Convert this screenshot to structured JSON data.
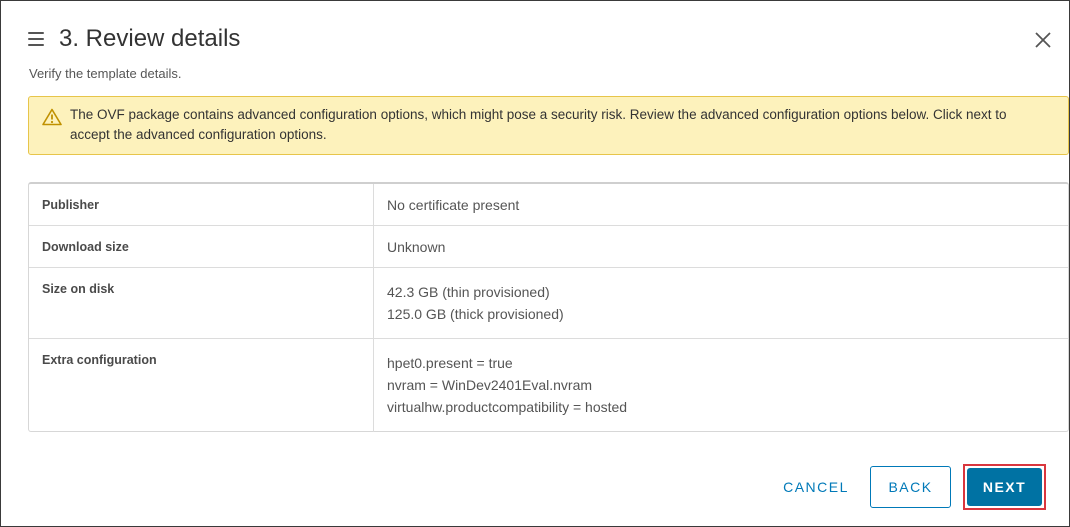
{
  "dialog": {
    "title": "3. Review details",
    "subtitle": "Verify the template details."
  },
  "alert": {
    "icon": "warning-triangle-icon",
    "text": "The OVF package contains advanced configuration options, which might pose a security risk. Review the advanced configuration options below. Click next to accept the advanced configuration options."
  },
  "details": [
    {
      "label": "Publisher",
      "values": [
        "No certificate present"
      ]
    },
    {
      "label": "Download size",
      "values": [
        "Unknown"
      ]
    },
    {
      "label": "Size on disk",
      "values": [
        "42.3 GB (thin provisioned)",
        "125.0 GB (thick provisioned)"
      ]
    },
    {
      "label": "Extra configuration",
      "values": [
        "hpet0.present = true",
        "nvram = WinDev2401Eval.nvram",
        "virtualhw.productcompatibility = hosted"
      ]
    }
  ],
  "buttons": {
    "cancel": "CANCEL",
    "back": "BACK",
    "next": "NEXT"
  },
  "colors": {
    "accent": "#0072a3",
    "alert_bg": "#fdf2bc",
    "alert_border": "#e7c54a",
    "highlight_border": "#d9363e"
  }
}
